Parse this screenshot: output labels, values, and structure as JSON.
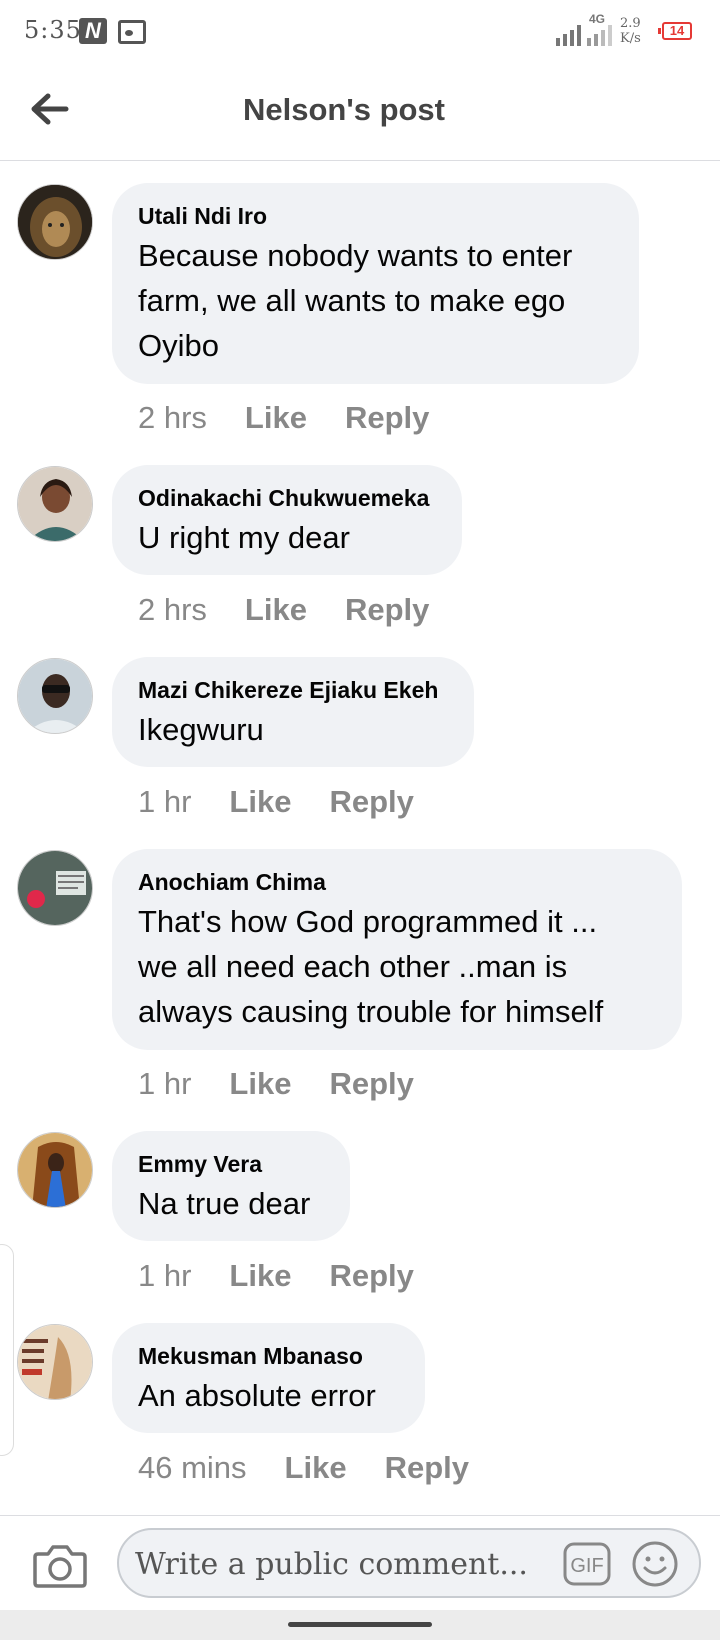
{
  "status_bar": {
    "time": "5:35",
    "network_type": "4G",
    "speed_value": "2.9",
    "speed_unit": "K/s",
    "battery": "14",
    "icons": [
      "n-notification-icon",
      "image-notification-icon",
      "signal-icon",
      "battery-icon"
    ]
  },
  "header": {
    "title": "Nelson's post",
    "back_icon": "arrow-left-icon"
  },
  "comments": [
    {
      "name": "Utali Ndi Iro",
      "lines": [
        "Because nobody wants to enter",
        "farm, we all wants to make ego",
        "Oyibo"
      ],
      "time": "2 hrs",
      "like": "Like",
      "reply": "Reply",
      "avatar_color": "#5a4a35"
    },
    {
      "name": "Odinakachi Chukwuemeka",
      "lines": [
        "U right my dear"
      ],
      "time": "2 hrs",
      "like": "Like",
      "reply": "Reply",
      "avatar_color": "#b06a5a"
    },
    {
      "name": "Mazi Chikereze Ejiaku Ekeh",
      "lines": [
        "Ikegwuru"
      ],
      "time": "1 hr",
      "like": "Like",
      "reply": "Reply",
      "avatar_color": "#8fa3b0"
    },
    {
      "name": "Anochiam Chima",
      "lines": [
        "That's how God programmed it ...",
        "we all need each other ..man is",
        "always causing trouble for himself"
      ],
      "time": "1 hr",
      "like": "Like",
      "reply": "Reply",
      "avatar_color": "#5f6f66"
    },
    {
      "name": "Emmy Vera",
      "lines": [
        "Na true dear"
      ],
      "time": "1 hr",
      "like": "Like",
      "reply": "Reply",
      "avatar_color": "#c8a060"
    },
    {
      "name": "Mekusman Mbanaso",
      "lines": [
        "An absolute error"
      ],
      "time": "46 mins",
      "like": "Like",
      "reply": "Reply",
      "avatar_color": "#c9a27a"
    }
  ],
  "composer": {
    "placeholder": "Write a public comment...",
    "camera_icon": "camera-icon",
    "gif_label": "GIF",
    "emoji_icon": "smiley-icon"
  },
  "colors": {
    "bubble": "#f0f2f5",
    "muted_text": "#888888",
    "title_text": "#444444",
    "battery_red": "#e53935"
  }
}
